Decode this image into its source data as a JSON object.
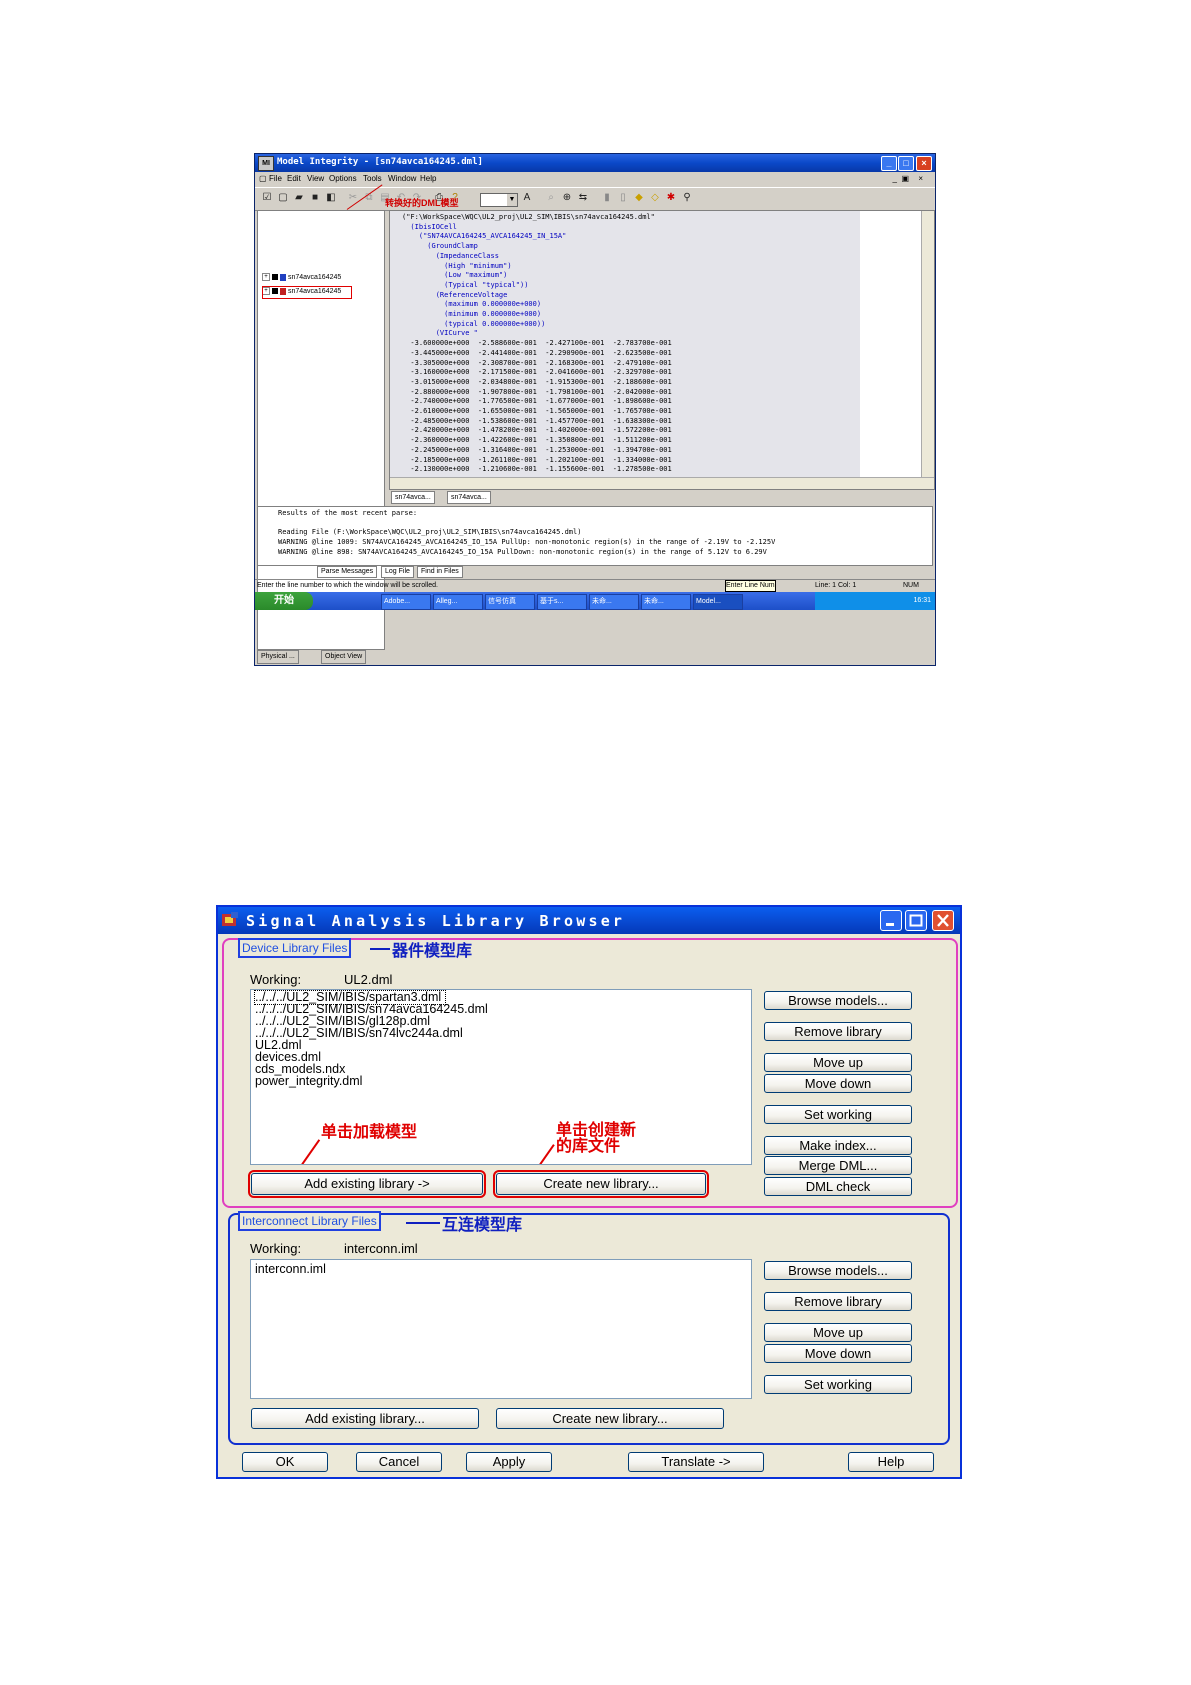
{
  "model_integrity": {
    "title": "Model Integrity - [sn74avca164245.dml]",
    "menu": [
      "File",
      "Edit",
      "View",
      "Options",
      "Tools",
      "Window",
      "Help"
    ],
    "tree": [
      "sn74avca164245",
      "sn74avca164245"
    ],
    "annotation": "转换好的DML模型",
    "left_tabs": [
      "Physical ...",
      "Object View"
    ],
    "code_lines": [
      "(\"F:\\WorkSpace\\WQC\\UL2_proj\\UL2_SIM\\IBIS\\sn74avca164245.dml\"",
      "  (IbisIOCell",
      "    (\"SN74AVCA164245_AVCA164245_IN_15A\"",
      "      (GroundClamp",
      "        (ImpedanceClass",
      "          (High \"minimum\")",
      "          (Low \"maximum\")",
      "          (Typical \"typical\"))",
      "        (ReferenceVoltage",
      "          (maximum 0.000000e+000)",
      "          (minimum 0.000000e+000)",
      "          (typical 0.000000e+000))",
      "        (VICurve \"",
      "  -3.600000e+000  -2.588600e-001  -2.427100e-001  -2.783700e-001",
      "  -3.445000e+000  -2.441400e-001  -2.290900e-001  -2.623500e-001",
      "  -3.305000e+000  -2.308700e-001  -2.168300e-001  -2.479100e-001",
      "  -3.160000e+000  -2.171500e-001  -2.041600e-001  -2.329700e-001",
      "  -3.015000e+000  -2.034800e-001  -1.915300e-001  -2.188600e-001",
      "  -2.880000e+000  -1.907800e-001  -1.798100e-001  -2.042000e-001",
      "  -2.740000e+000  -1.776500e-001  -1.677000e-001  -1.898600e-001",
      "  -2.610000e+000  -1.655000e-001  -1.565000e-001  -1.765700e-001",
      "  -2.485000e+000  -1.538600e-001  -1.457700e-001  -1.638300e-001",
      "  -2.420000e+000  -1.478200e-001  -1.402000e-001  -1.572200e-001",
      "  -2.360000e+000  -1.422600e-001  -1.350800e-001  -1.511200e-001",
      "  -2.245000e+000  -1.316400e-001  -1.253000e-001  -1.394700e-001",
      "  -2.185000e+000  -1.261100e-001  -1.202100e-001  -1.334000e-001",
      "  -2.130000e+000  -1.210600e-001  -1.155600e-001  -1.278500e-001"
    ],
    "doc_tabs": [
      "sn74avca...",
      "sn74avca..."
    ],
    "messages": [
      "Results of the most recent parse:",
      "",
      "Reading File (F:\\WorkSpace\\WQC\\UL2_proj\\UL2_SIM\\IBIS\\sn74avca164245.dml)",
      "WARNING @line 1009: SN74AVCA164245_AVCA164245_IO_15A PullUp: non-monotonic region(s) in the range of -2.19V to -2.125V",
      "WARNING @line 898: SN74AVCA164245_AVCA164245_IO_15A PullDown: non-monotonic region(s) in the range of 5.12V to 6.29V"
    ],
    "msg_tabs": [
      "Parse Messages",
      "Log File",
      "Find in Files"
    ],
    "status": {
      "left": "Enter the line number to which the window will be scrolled.",
      "tooltip": "Enter Line Num",
      "position": "Line: 1 Col: 1",
      "mode": "NUM"
    },
    "taskbar": {
      "start": "开始",
      "tasks": [
        "Adobe...",
        "Alleg...",
        "信号仿真",
        "基于s...",
        "未命...",
        "未命...",
        "Model..."
      ],
      "clock": "16:31"
    }
  },
  "library_browser": {
    "title": "Signal Analysis Library Browser",
    "device": {
      "group_label": "Device Library Files",
      "note": "器件模型库",
      "working_label": "Working:",
      "working_value": "UL2.dml",
      "items": [
        "../../../UL2_SIM/IBIS/spartan3.dml",
        "../../../UL2_SIM/IBIS/sn74avca164245.dml",
        "../../../UL2_SIM/IBIS/gl128p.dml",
        "../../../UL2_SIM/IBIS/sn74lvc244a.dml",
        "UL2.dml",
        "devices.dml",
        "cds_models.ndx",
        "power_integrity.dml"
      ],
      "note_add": "单击加载模型",
      "note_create_1": "单击创建新",
      "note_create_2": "的库文件",
      "add_button": "Add existing library ->",
      "create_button": "Create new library...",
      "side_buttons": {
        "browse": "Browse models...",
        "remove": "Remove library",
        "up": "Move up",
        "down": "Move down",
        "set": "Set working",
        "index": "Make index...",
        "merge": "Merge DML...",
        "check": "DML check"
      }
    },
    "interconnect": {
      "group_label": "Interconnect Library Files",
      "note": "互连模型库",
      "working_label": "Working:",
      "working_value": "interconn.iml",
      "items": [
        "interconn.iml"
      ],
      "add_button": "Add existing library...",
      "create_button": "Create new library...",
      "side_buttons": {
        "browse": "Browse models...",
        "remove": "Remove library",
        "up": "Move up",
        "down": "Move down",
        "set": "Set working"
      }
    },
    "bottom_buttons": {
      "ok": "OK",
      "cancel": "Cancel",
      "apply": "Apply",
      "translate": "Translate ->",
      "help": "Help"
    }
  }
}
